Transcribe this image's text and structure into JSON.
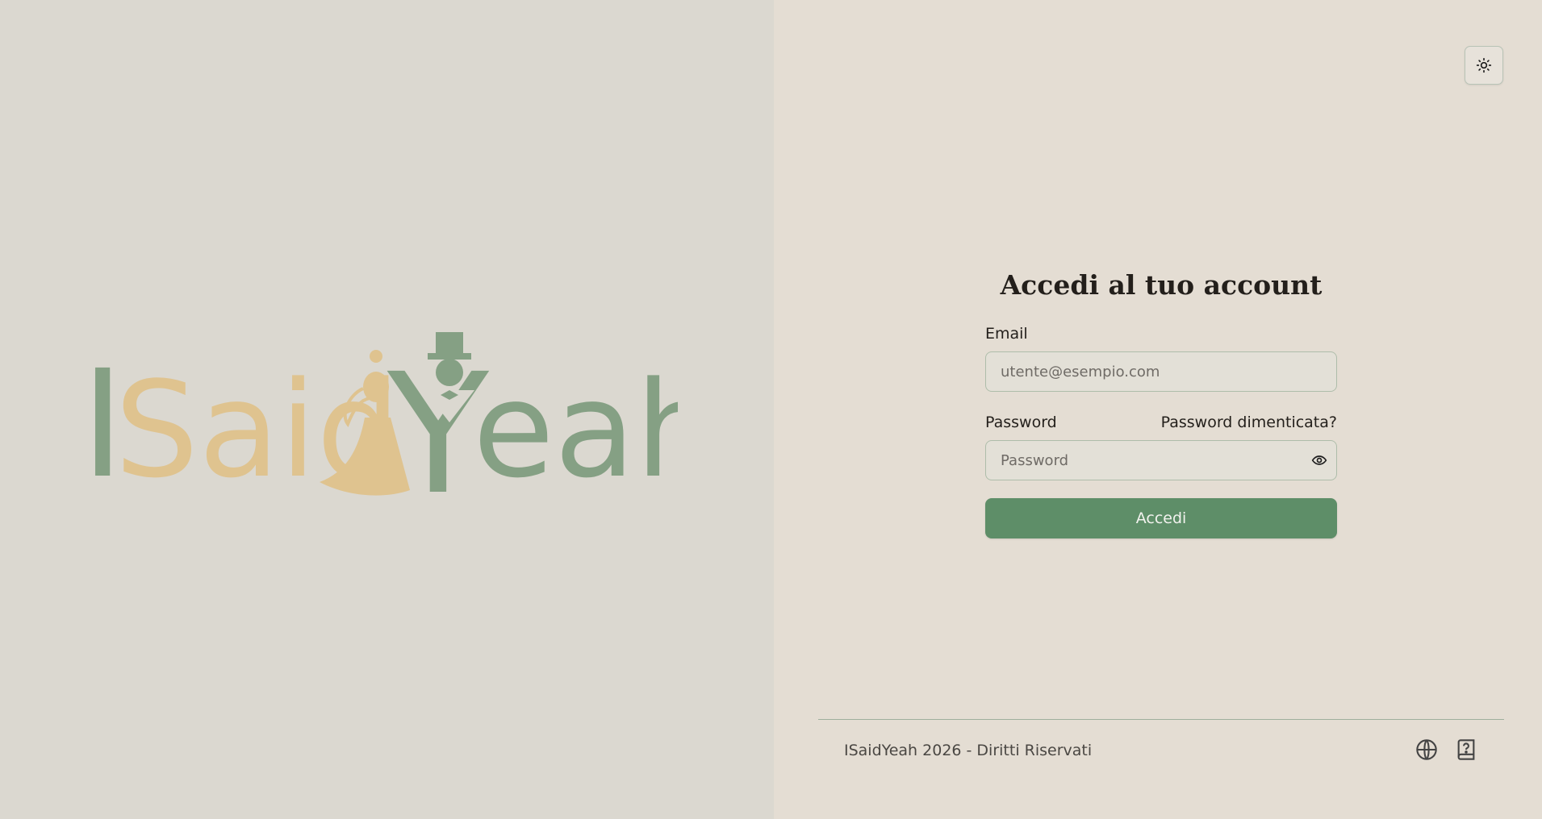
{
  "brand": {
    "logo_text": "ISaidYeah",
    "logo_parts": [
      "I",
      "Said",
      "Y",
      "eah"
    ],
    "colors": {
      "green": "#85a084",
      "gold": "#dfc38f",
      "accent": "#5e8e68"
    }
  },
  "header": {
    "theme_toggle_icon": "sun-icon"
  },
  "login": {
    "title": "Accedi al tuo account",
    "email_label": "Email",
    "email_placeholder": "utente@esempio.com",
    "email_value": "",
    "password_label": "Password",
    "forgot_password": "Password dimenticata?",
    "password_placeholder": "Password",
    "password_value": "",
    "show_password_icon": "eye-icon",
    "submit_label": "Accedi"
  },
  "footer": {
    "copyright": "ISaidYeah 2026 - Diritti Riservati",
    "language_icon": "globe-icon",
    "help_icon": "help-book-icon"
  }
}
